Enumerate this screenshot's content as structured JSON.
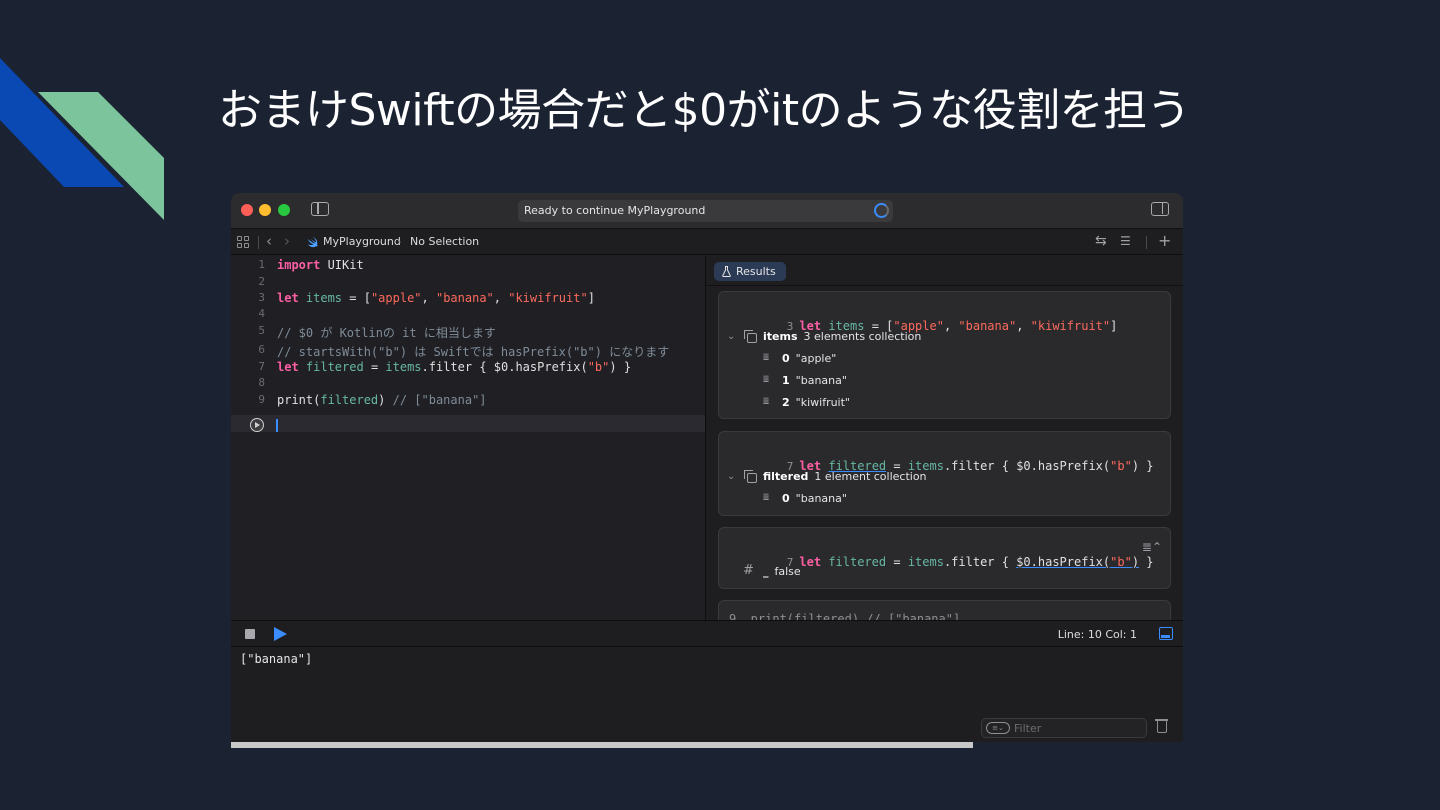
{
  "slide": {
    "title": "おまけSwiftの場合だと$0がitのような役割を担う",
    "colors": {
      "background": "#1b2232",
      "deco_blue": "#0a49b4",
      "deco_green": "#7cc49c"
    }
  },
  "window": {
    "status_text": "Ready to continue MyPlayground",
    "breadcrumb": {
      "project": "MyPlayground",
      "selection": "No Selection"
    }
  },
  "editor": {
    "lines": [
      {
        "no": "1",
        "tokens": [
          {
            "t": "import",
            "c": "kw"
          },
          {
            "t": " UIKit",
            "c": "plain"
          }
        ]
      },
      {
        "no": "2",
        "tokens": []
      },
      {
        "no": "3",
        "tokens": [
          {
            "t": "let",
            "c": "kw"
          },
          {
            "t": " items",
            "c": "ident"
          },
          {
            "t": " = [",
            "c": "plain"
          },
          {
            "t": "\"apple\"",
            "c": "str"
          },
          {
            "t": ", ",
            "c": "plain"
          },
          {
            "t": "\"banana\"",
            "c": "str"
          },
          {
            "t": ", ",
            "c": "plain"
          },
          {
            "t": "\"kiwifruit\"",
            "c": "str"
          },
          {
            "t": "]",
            "c": "plain"
          }
        ]
      },
      {
        "no": "4",
        "tokens": []
      },
      {
        "no": "5",
        "tokens": [
          {
            "t": "// $0 が Kotlinの it に相当します",
            "c": "cmt"
          }
        ]
      },
      {
        "no": "6",
        "tokens": [
          {
            "t": "// startsWith(\"b\") は Swiftでは hasPrefix(\"b\") になります",
            "c": "cmt"
          }
        ]
      },
      {
        "no": "7",
        "tokens": [
          {
            "t": "let",
            "c": "kw"
          },
          {
            "t": " filtered",
            "c": "ident"
          },
          {
            "t": " = ",
            "c": "plain"
          },
          {
            "t": "items",
            "c": "ident"
          },
          {
            "t": ".filter { $0.hasPrefix(",
            "c": "plain"
          },
          {
            "t": "\"b\"",
            "c": "str"
          },
          {
            "t": ") }",
            "c": "plain"
          }
        ]
      },
      {
        "no": "8",
        "tokens": []
      },
      {
        "no": "9",
        "tokens": [
          {
            "t": "print(",
            "c": "plain"
          },
          {
            "t": "filtered",
            "c": "ident"
          },
          {
            "t": ") ",
            "c": "plain"
          },
          {
            "t": "// [\"banana\"]",
            "c": "cmt"
          }
        ]
      }
    ]
  },
  "results": {
    "tab_label": "Results",
    "card1": {
      "line_no": "3",
      "code_parts": [
        "let",
        " items",
        " = [",
        "\"apple\"",
        ", ",
        "\"banana\"",
        ", ",
        "\"kiwifruit\"",
        "]"
      ],
      "var_name": "items",
      "summary": "3 elements collection",
      "elements": [
        {
          "index": "0",
          "value": "\"apple\""
        },
        {
          "index": "1",
          "value": "\"banana\""
        },
        {
          "index": "2",
          "value": "\"kiwifruit\""
        }
      ]
    },
    "card2": {
      "line_no": "7",
      "code_parts": [
        "let",
        " ",
        "filtered",
        " = ",
        "items",
        ".filter { $0.hasPrefix(",
        "\"b\"",
        ") }"
      ],
      "var_name": "filtered",
      "summary": "1 element collection",
      "elements": [
        {
          "index": "0",
          "value": "\"banana\""
        }
      ]
    },
    "card3": {
      "line_no": "7",
      "code_parts": [
        "let",
        " filtered",
        " = ",
        "items",
        ".filter { ",
        "$0.hasPrefix(",
        "\"b\"",
        ")",
        " }"
      ],
      "value_label": "_",
      "value": "false"
    },
    "card4_peek": "9  print(filtered) // [\"banana\"]"
  },
  "debug": {
    "line_col": "Line: 10  Col: 1"
  },
  "console": {
    "output": "[\"banana\"]",
    "filter_placeholder": "Filter"
  }
}
